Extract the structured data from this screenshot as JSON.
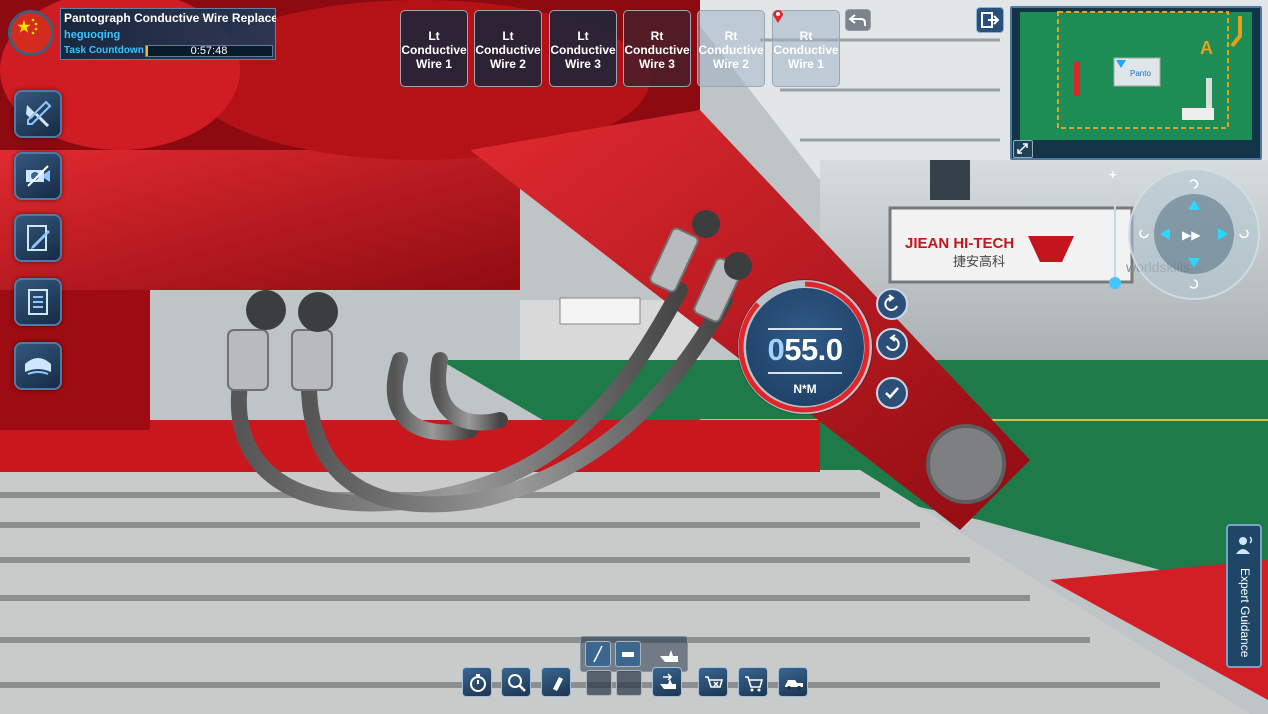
{
  "task": {
    "title": "Pantograph Conductive Wire Replacen",
    "user": "heguoqing",
    "countdown_label": "Task Countdown",
    "countdown_time": "0:57:48",
    "flag_icon": "china-flag-icon"
  },
  "wire_tabs": [
    {
      "line1": "Lt",
      "line2": "Conductive",
      "line3": "Wire 1",
      "style": "dark"
    },
    {
      "line1": "Lt",
      "line2": "Conductive",
      "line3": "Wire 2",
      "style": "dark"
    },
    {
      "line1": "Lt",
      "line2": "Conductive",
      "line3": "Wire 3",
      "style": "dark"
    },
    {
      "line1": "Rt",
      "line2": "Conductive",
      "line3": "Wire 3",
      "style": "red"
    },
    {
      "line1": "Rt",
      "line2": "Conductive",
      "line3": "Wire 2",
      "style": "light"
    },
    {
      "line1": "Rt",
      "line2": "Conductive",
      "line3": "Wire 1",
      "style": "light"
    }
  ],
  "scene_signs": {
    "brand_en": "JIEAN HI-TECH",
    "brand_cn": "捷安高科",
    "worldskills": "worldskills"
  },
  "minimap": {
    "marker_label": "Panto"
  },
  "torque": {
    "value_lead": "0",
    "value_rest": "55.0",
    "unit": "N*M"
  },
  "expert_guidance": "Expert Guidance",
  "colors": {
    "accent_blue": "#3cc3ff",
    "panel_dark": "#1c3550",
    "machine_red": "#c4161c",
    "floor_green": "#1f7a4a"
  }
}
